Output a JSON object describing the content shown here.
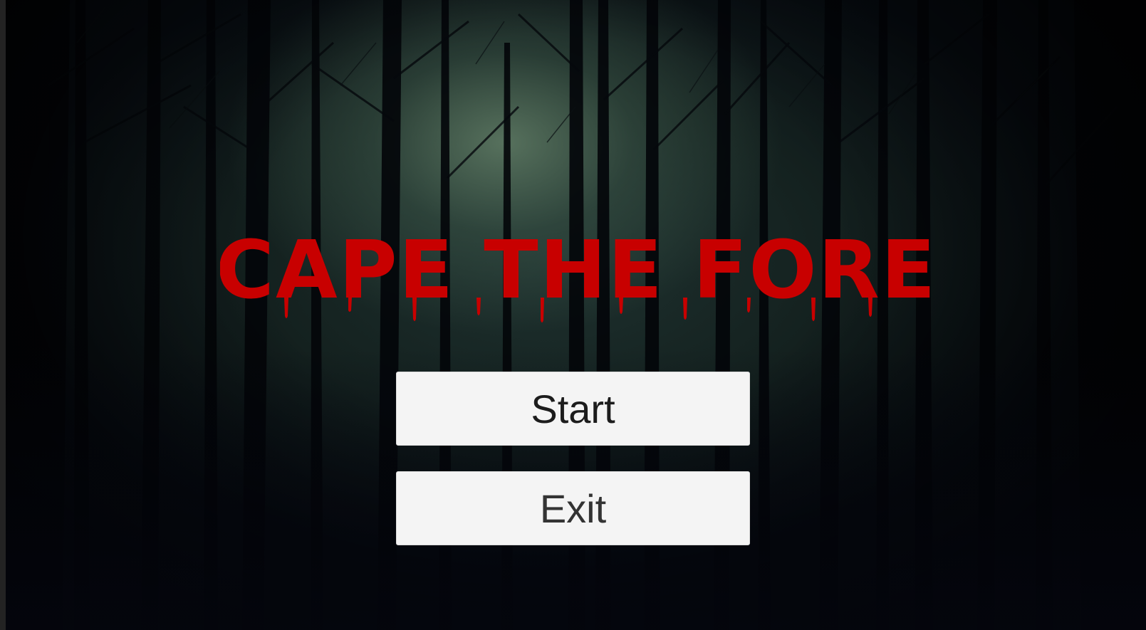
{
  "game": {
    "title": "ESCAPE THE FOREST"
  },
  "menu": {
    "start_label": "Start",
    "exit_label": "Exit"
  },
  "colors": {
    "title": "#c80000",
    "button_background": "#f4f4f4",
    "button_text": "#1c1c1c"
  }
}
